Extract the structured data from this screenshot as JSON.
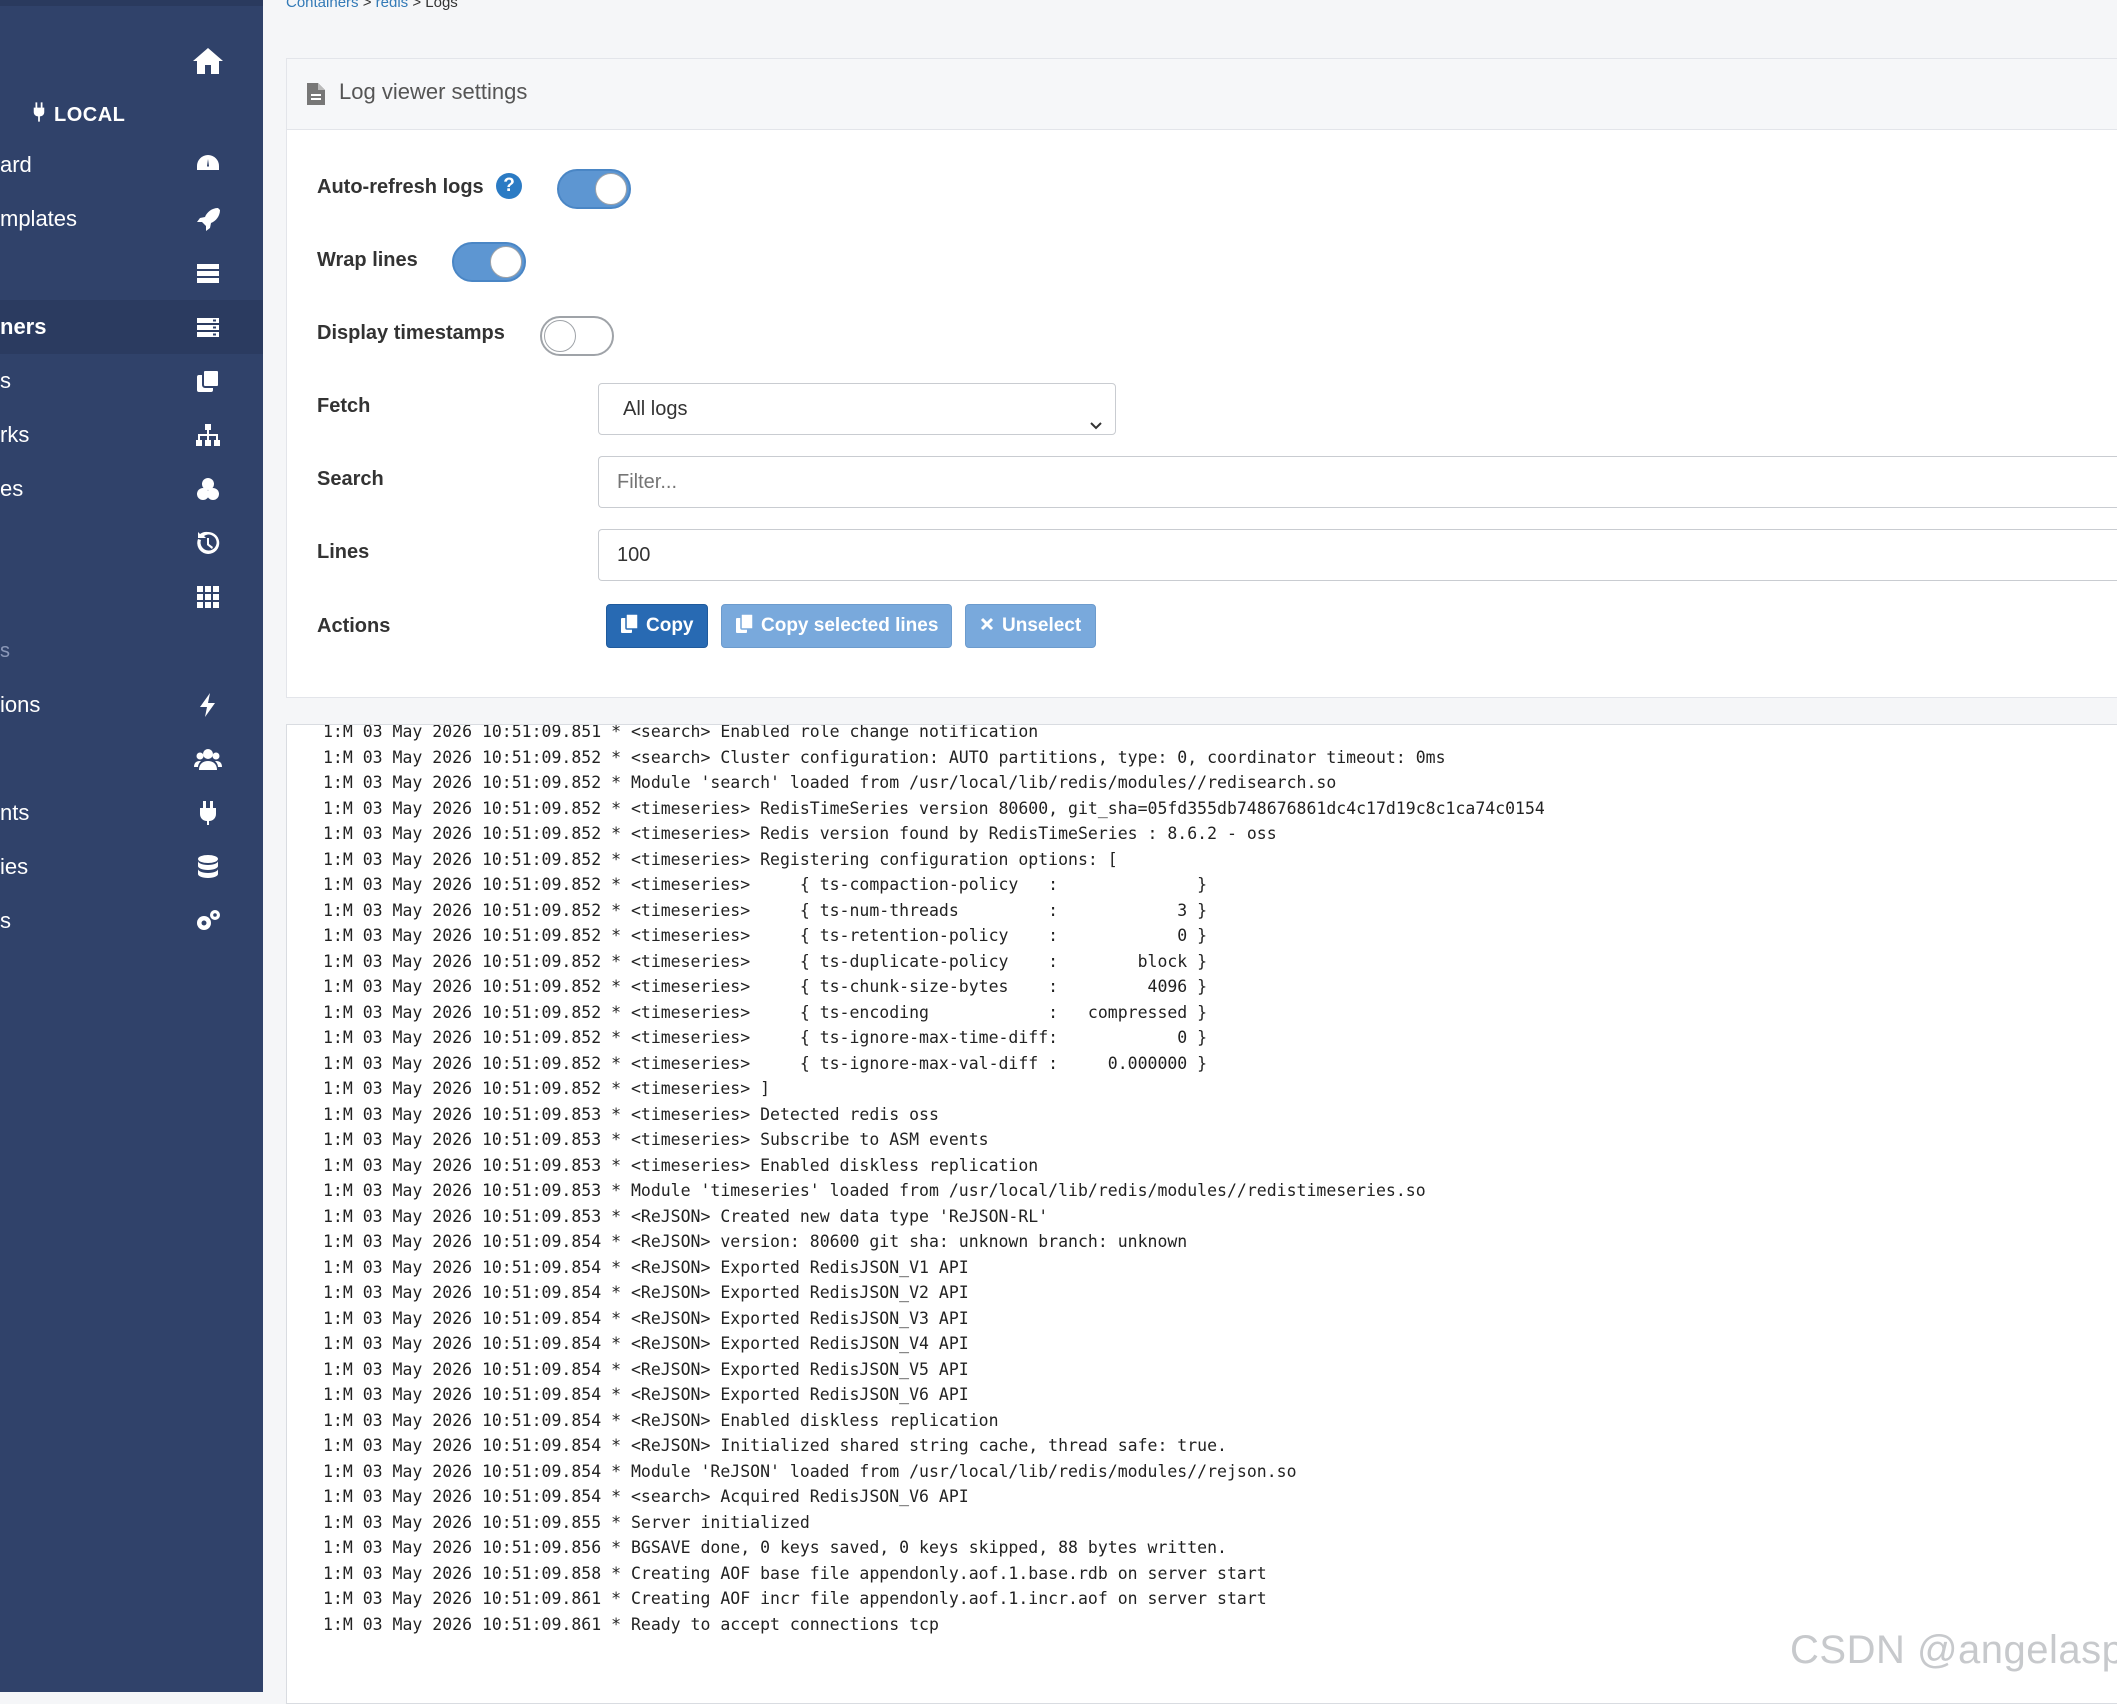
{
  "sidebar": {
    "environment": "LOCAL",
    "items": [
      {
        "label": "ard",
        "icon": "dashboard-icon"
      },
      {
        "label": "mplates",
        "icon": "rocket-icon"
      },
      {
        "label": "",
        "icon": "stacks-icon"
      },
      {
        "label": "ners",
        "icon": "containers-icon",
        "active": true
      },
      {
        "label": "s",
        "icon": "images-icon"
      },
      {
        "label": "rks",
        "icon": "networks-icon"
      },
      {
        "label": "es",
        "icon": "volumes-icon"
      },
      {
        "label": "",
        "icon": "history-icon"
      },
      {
        "label": "",
        "icon": "grid-icon"
      },
      {
        "label": "s",
        "icon": "",
        "section": true
      },
      {
        "label": "ions",
        "icon": "bolt-icon"
      },
      {
        "label": "",
        "icon": "users-icon"
      },
      {
        "label": "nts",
        "icon": "plug-icon"
      },
      {
        "label": "ies",
        "icon": "database-icon"
      },
      {
        "label": "s",
        "icon": "settings-icon"
      }
    ]
  },
  "breadcrumb": {
    "items": [
      "Containers",
      "redis"
    ],
    "separator": ">",
    "current": "Logs"
  },
  "settings": {
    "title": "Log viewer settings",
    "auto_refresh_label": "Auto-refresh logs",
    "auto_refresh": true,
    "help_glyph": "?",
    "wrap_lines_label": "Wrap lines",
    "wrap_lines": true,
    "timestamps_label": "Display timestamps",
    "timestamps": false,
    "fetch_label": "Fetch",
    "fetch_value": "All logs",
    "search_label": "Search",
    "search_placeholder": "Filter...",
    "lines_label": "Lines",
    "lines_value": "100",
    "actions_label": "Actions",
    "copy_label": "Copy",
    "copy_selected_label": "Copy selected lines",
    "unselect_label": "Unselect"
  },
  "colors": {
    "sidebar": "#30426a",
    "primary_button": "#286ab3",
    "disabled_button": "#79a9dc",
    "toggle_on": "#5d96d2",
    "link": "#337ab7"
  },
  "logs": [
    "1:M 03 May 2026 10:51:09.851 * <search> Enabled role change notification",
    "1:M 03 May 2026 10:51:09.852 * <search> Cluster configuration: AUTO partitions, type: 0, coordinator timeout: 0ms",
    "1:M 03 May 2026 10:51:09.852 * Module 'search' loaded from /usr/local/lib/redis/modules//redisearch.so",
    "1:M 03 May 2026 10:51:09.852 * <timeseries> RedisTimeSeries version 80600, git_sha=05fd355db748676861dc4c17d19c8c1ca74c0154",
    "1:M 03 May 2026 10:51:09.852 * <timeseries> Redis version found by RedisTimeSeries : 8.6.2 - oss",
    "1:M 03 May 2026 10:51:09.852 * <timeseries> Registering configuration options: [",
    "1:M 03 May 2026 10:51:09.852 * <timeseries>     { ts-compaction-policy   :              }",
    "1:M 03 May 2026 10:51:09.852 * <timeseries>     { ts-num-threads         :            3 }",
    "1:M 03 May 2026 10:51:09.852 * <timeseries>     { ts-retention-policy    :            0 }",
    "1:M 03 May 2026 10:51:09.852 * <timeseries>     { ts-duplicate-policy    :        block }",
    "1:M 03 May 2026 10:51:09.852 * <timeseries>     { ts-chunk-size-bytes    :         4096 }",
    "1:M 03 May 2026 10:51:09.852 * <timeseries>     { ts-encoding            :   compressed }",
    "1:M 03 May 2026 10:51:09.852 * <timeseries>     { ts-ignore-max-time-diff:            0 }",
    "1:M 03 May 2026 10:51:09.852 * <timeseries>     { ts-ignore-max-val-diff :     0.000000 }",
    "1:M 03 May 2026 10:51:09.852 * <timeseries> ]",
    "1:M 03 May 2026 10:51:09.853 * <timeseries> Detected redis oss",
    "1:M 03 May 2026 10:51:09.853 * <timeseries> Subscribe to ASM events",
    "1:M 03 May 2026 10:51:09.853 * <timeseries> Enabled diskless replication",
    "1:M 03 May 2026 10:51:09.853 * Module 'timeseries' loaded from /usr/local/lib/redis/modules//redistimeseries.so",
    "1:M 03 May 2026 10:51:09.853 * <ReJSON> Created new data type 'ReJSON-RL'",
    "1:M 03 May 2026 10:51:09.854 * <ReJSON> version: 80600 git sha: unknown branch: unknown",
    "1:M 03 May 2026 10:51:09.854 * <ReJSON> Exported RedisJSON_V1 API",
    "1:M 03 May 2026 10:51:09.854 * <ReJSON> Exported RedisJSON_V2 API",
    "1:M 03 May 2026 10:51:09.854 * <ReJSON> Exported RedisJSON_V3 API",
    "1:M 03 May 2026 10:51:09.854 * <ReJSON> Exported RedisJSON_V4 API",
    "1:M 03 May 2026 10:51:09.854 * <ReJSON> Exported RedisJSON_V5 API",
    "1:M 03 May 2026 10:51:09.854 * <ReJSON> Exported RedisJSON_V6 API",
    "1:M 03 May 2026 10:51:09.854 * <ReJSON> Enabled diskless replication",
    "1:M 03 May 2026 10:51:09.854 * <ReJSON> Initialized shared string cache, thread safe: true.",
    "1:M 03 May 2026 10:51:09.854 * Module 'ReJSON' loaded from /usr/local/lib/redis/modules//rejson.so",
    "1:M 03 May 2026 10:51:09.854 * <search> Acquired RedisJSON_V6 API",
    "1:M 03 May 2026 10:51:09.855 * Server initialized",
    "1:M 03 May 2026 10:51:09.856 * BGSAVE done, 0 keys saved, 0 keys skipped, 88 bytes written.",
    "1:M 03 May 2026 10:51:09.858 * Creating AOF base file appendonly.aof.1.base.rdb on server start",
    "1:M 03 May 2026 10:51:09.861 * Creating AOF incr file appendonly.aof.1.incr.aof on server start",
    "1:M 03 May 2026 10:51:09.861 * Ready to accept connections tcp"
  ],
  "watermark": "CSDN @angelasp"
}
